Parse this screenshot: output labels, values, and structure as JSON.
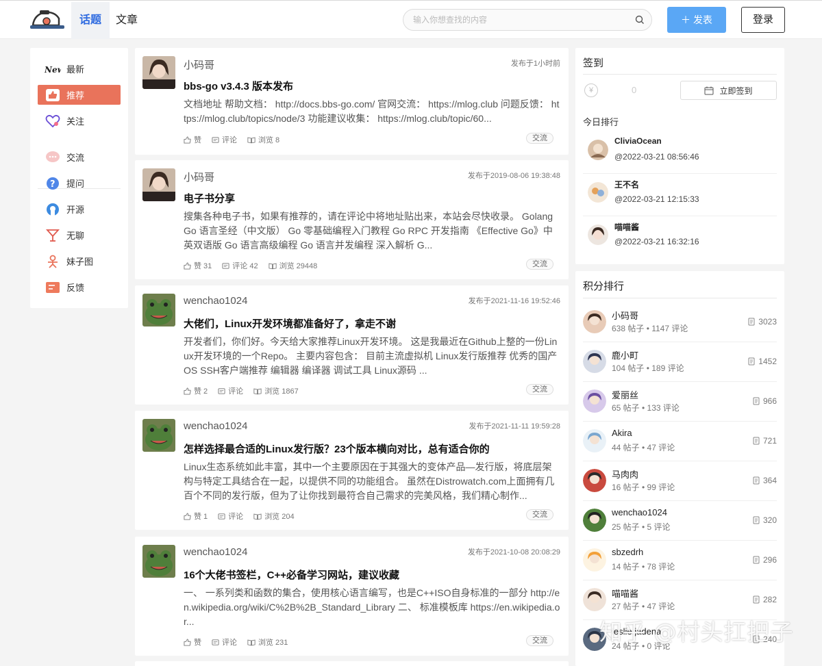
{
  "header": {
    "tabs": [
      {
        "label": "话题",
        "active": true
      },
      {
        "label": "文章",
        "active": false
      }
    ],
    "search_placeholder": "输入你想查找的内容",
    "post_button": "发表",
    "login_button": "登录"
  },
  "sidebar": {
    "items": [
      {
        "label": "最新",
        "icon": "new-icon"
      },
      {
        "label": "推荐",
        "icon": "thumbs-up-icon",
        "active": true
      },
      {
        "label": "关注",
        "icon": "heart-icon"
      },
      {
        "label": "交流",
        "icon": "chat-bubble-icon"
      },
      {
        "label": "提问",
        "icon": "question-icon"
      },
      {
        "label": "开源",
        "icon": "open-source-icon"
      },
      {
        "label": "无聊",
        "icon": "cocktail-icon"
      },
      {
        "label": "妹子图",
        "icon": "girl-icon"
      },
      {
        "label": "反馈",
        "icon": "feedback-icon"
      }
    ]
  },
  "posts": [
    {
      "author": "小码哥",
      "time": "发布于1小时前",
      "title": "bbs-go v3.4.3 版本发布",
      "summary": "文档地址 帮助文档：  http://docs.bbs-go.com/  官网交流：  https://mlog.club  问题反馈：  https://mlog.club/topics/node/3  功能建议收集：  https://mlog.club/topic/60...",
      "likes": "赞",
      "comments": "评论",
      "views": "浏览 8",
      "tag": "交流"
    },
    {
      "author": "小码哥",
      "time": "发布于2019-08-06 19:38:48",
      "title": "电子书分享",
      "summary": "搜集各种电子书，如果有推荐的，请在评论中将地址贴出来，本站会尽快收录。 Golang Go 语言圣经（中文版） Go 零基础编程入门教程 Go RPC 开发指南 《Effective Go》中英双语版 Go 语言高级编程 Go 语言并发编程 深入解析 G...",
      "likes": "赞 31",
      "comments": "评论 42",
      "views": "浏览 29448",
      "tag": "交流"
    },
    {
      "author": "wenchao1024",
      "time": "发布于2021-11-16 19:52:46",
      "title": "大佬们，Linux开发环境都准备好了，拿走不谢",
      "summary": "开发者们，你们好。今天给大家推荐Linux开发环境。 这是我最近在Github上整的一份Linux开发环境的一个Repo。 主要内容包含： 目前主流虚拟机 Linux发行版推荐 优秀的国产OS SSH客户端推荐 编辑器 编译器 调试工具 Linux源码 ...",
      "likes": "赞 2",
      "comments": "评论",
      "views": "浏览 1867",
      "tag": "交流"
    },
    {
      "author": "wenchao1024",
      "time": "发布于2021-11-11 19:59:28",
      "title": "怎样选择最合适的Linux发行版？23个版本横向对比，总有适合你的",
      "summary": "Linux生态系统如此丰富，其中一个主要原因在于其强大的变体产品—发行版，将底层架构与特定工具结合在一起，以提供不同的功能组合。 虽然在Distrowatch.com上面拥有几百个不同的发行版，但为了让你找到最符合自己需求的完美风格，我们精心制作...",
      "likes": "赞 1",
      "comments": "评论",
      "views": "浏览 204",
      "tag": "交流"
    },
    {
      "author": "wenchao1024",
      "time": "发布于2021-10-08 20:08:29",
      "title": "16个大佬书签栏，C++必备学习网站，建议收藏",
      "summary": "一、 一系列类和函数的集合，使用核心语言编写，也是C++ISO自身标准的一部分 http://en.wikipedia.org/wiki/C%2B%2B_Standard_Library 二、 标准模板库 https://en.wikipedia.or...",
      "likes": "赞",
      "comments": "评论",
      "views": "浏览 231",
      "tag": "交流"
    }
  ],
  "checkin": {
    "title": "签到",
    "coin_symbol": "¥",
    "coins": "0",
    "button": "立即签到",
    "today_title": "今日排行",
    "today": [
      {
        "name": "CliviaOcean",
        "time": "@2022-03-21 08:56:46"
      },
      {
        "name": "王不名",
        "time": "@2022-03-21 12:15:33"
      },
      {
        "name": "喵喵酱",
        "time": "@2022-03-21 16:32:16"
      }
    ]
  },
  "score_rank": {
    "title": "积分排行",
    "items": [
      {
        "name": "小码哥",
        "meta": "638 帖子 • 1147 评论",
        "score": "3023"
      },
      {
        "name": "鹿小町",
        "meta": "104 帖子 • 189 评论",
        "score": "1452"
      },
      {
        "name": "爱丽丝",
        "meta": "65 帖子 • 133 评论",
        "score": "966"
      },
      {
        "name": "Akira",
        "meta": "44 帖子 • 47 评论",
        "score": "721"
      },
      {
        "name": "马肉肉",
        "meta": "16 帖子 • 99 评论",
        "score": "364"
      },
      {
        "name": "wenchao1024",
        "meta": "25 帖子 • 5 评论",
        "score": "320"
      },
      {
        "name": "sbzedrh",
        "meta": "14 帖子 • 78 评论",
        "score": "296"
      },
      {
        "name": "喵喵酱",
        "meta": "27 帖子 • 47 评论",
        "score": "282"
      },
      {
        "name": "leslie jadena",
        "meta": "24 帖子 • 0 评论",
        "score": "240"
      }
    ]
  },
  "watermark": "知乎 @村头扛把子",
  "colors": {
    "accent_blue": "#2f6be0",
    "post_button": "#5aa7f5",
    "active_sidebar": "#e9735b"
  }
}
